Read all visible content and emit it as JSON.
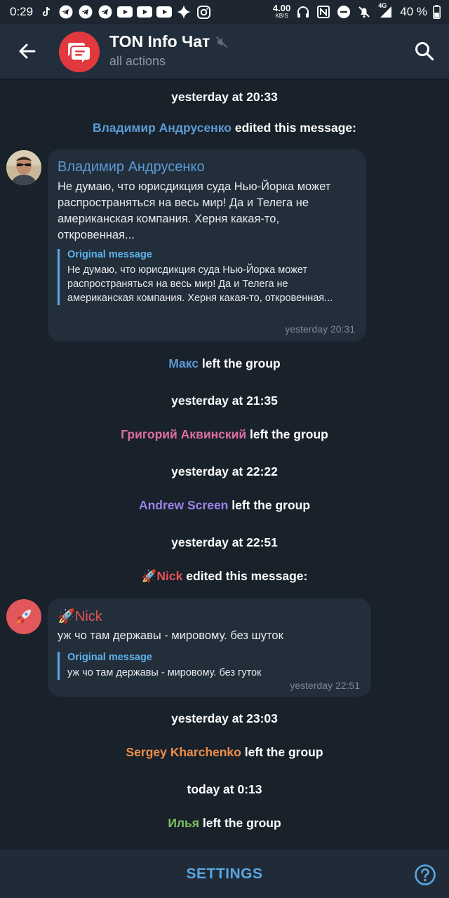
{
  "status_bar": {
    "time": "0:29",
    "speed_value": "4.00",
    "speed_unit": "KB/S",
    "network": "4G",
    "battery": "40 %"
  },
  "header": {
    "title": "TON Info Чат",
    "subtitle": "all actions"
  },
  "feed": {
    "d1": "yesterday at 20:33",
    "e1_who": "Владимир Андрусенко",
    "e1_rest": " edited this message:",
    "m1": {
      "author": "Владимир Андрусенко",
      "text_lines": [
        "Не думаю, что юрисдикция суда Нью-Йорка может",
        "распространяться на весь мир! Да и Телега не",
        "американская компания. Херня какая-то,",
        "откровенная..."
      ],
      "original_title": "Original message",
      "original_lines": [
        "Не думаю, что юрисдикция суда Нью-Йорка может",
        "распространяться на весь мир! Да и Телега не",
        "американская  компания. Херня какая-то, откровенная..."
      ],
      "time": "yesterday 20:31"
    },
    "e2_who": "Макс",
    "e2_rest": " left the group",
    "d2": "yesterday at 21:35",
    "e3_who": "Григорий Аквинский",
    "e3_rest": " left the group",
    "d3": "yesterday at 22:22",
    "e4_who": "Andrew Screen",
    "e4_rest": " left the group",
    "d4": "yesterday at 22:51",
    "e5_who": "🚀Nick",
    "e5_rest": " edited this message:",
    "m2": {
      "author": "🚀Nick",
      "text": "уж чо там державы - мировому. без шуток",
      "original_title": "Original message",
      "original_text": "уж чо там державы - мировому. без гуток",
      "time": "yesterday 22:51"
    },
    "d5": "yesterday at 23:03",
    "e6_who": "Sergey Kharchenko",
    "e6_rest": " left the group",
    "d6": "today at 0:13",
    "e7_who": "Илья",
    "e7_rest": " left the group"
  },
  "bottom": {
    "settings_label": "SETTINGS"
  },
  "colors": {
    "background": "#19212b",
    "header": "#222e3b",
    "bubble": "#232e3b",
    "accent_blue": "#5aa6e4",
    "name_vladimir": "#5b9bd5",
    "name_maks": "#5b9bd5",
    "name_grigoriy": "#de6fa2",
    "name_andrew": "#9a84e8",
    "name_nick": "#e45356",
    "name_sergey": "#ef8f49",
    "name_ilya": "#7ac25e"
  }
}
